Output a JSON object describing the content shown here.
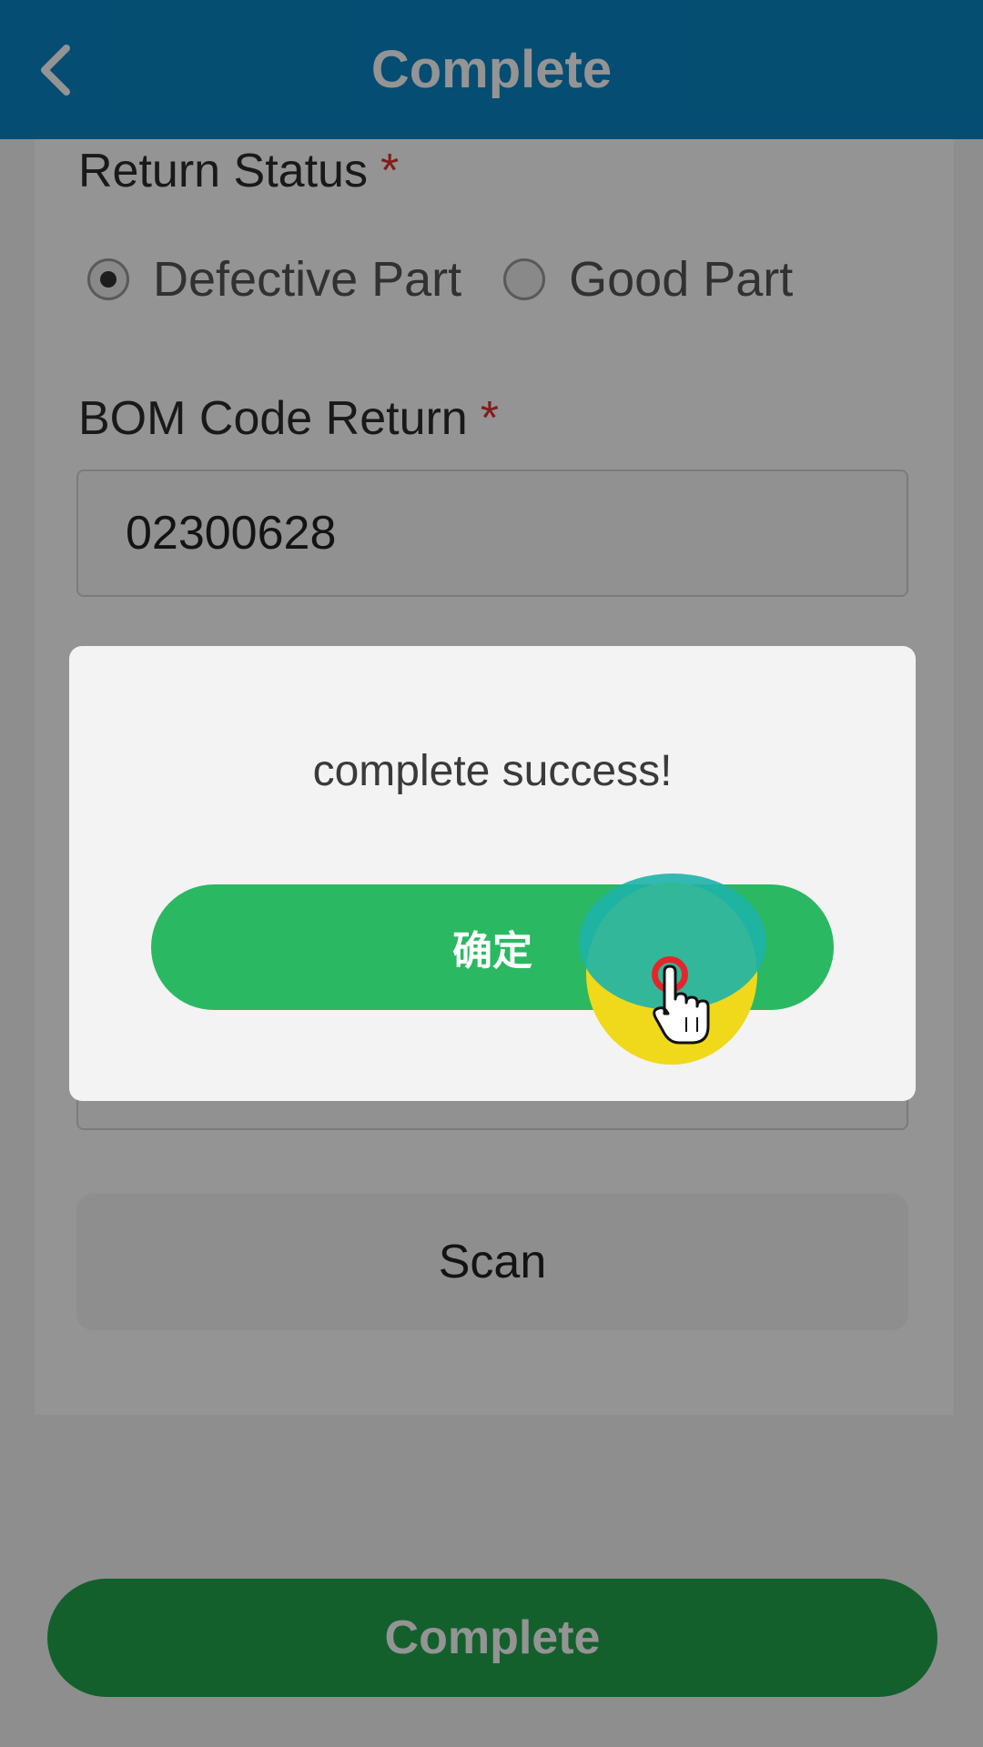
{
  "header": {
    "title": "Complete",
    "back_icon": "chevron-left-icon"
  },
  "form": {
    "return_status": {
      "label": "Return Status",
      "required_mark": "*",
      "options": [
        {
          "label": "Defective Part",
          "selected": true
        },
        {
          "label": "Good Part",
          "selected": false
        }
      ]
    },
    "bom_code_return": {
      "label": "BOM Code Return",
      "required_mark": "*",
      "value": "02300628"
    },
    "scan_button_label": "Scan",
    "complete_button_label": "Complete"
  },
  "dialog": {
    "message": "complete success!",
    "ok_button_label": "确定"
  },
  "colors": {
    "header": "#0a85c4",
    "primary_green": "#22a64e",
    "dialog_button": "#2bb862",
    "required": "#e0322c"
  }
}
